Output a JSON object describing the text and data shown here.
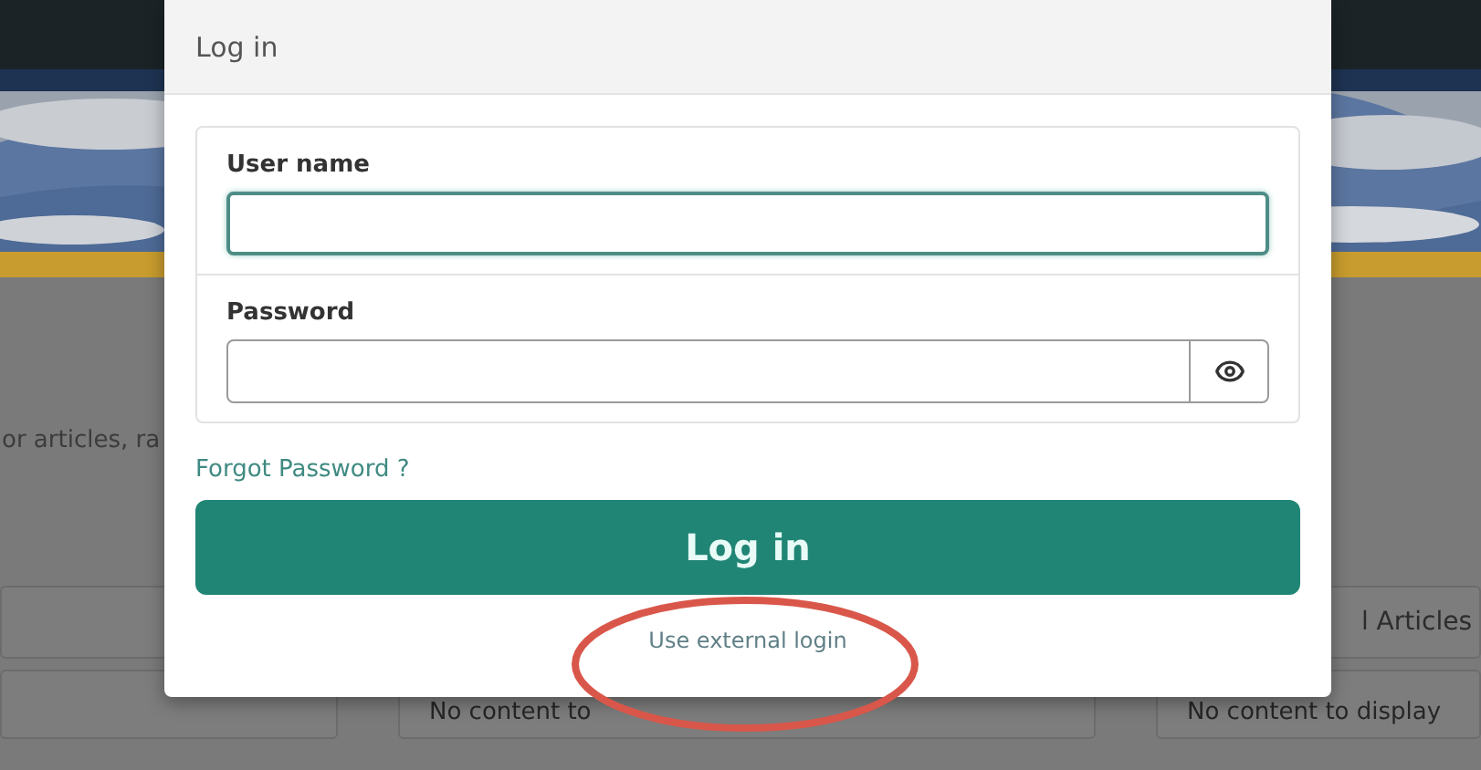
{
  "page": {
    "intro_text": "or articles, ra",
    "cards": [
      {
        "content": "No content to"
      },
      {
        "heading": "l Articles",
        "content": "No content to display"
      }
    ]
  },
  "dialog": {
    "title": "Log in",
    "fields": [
      {
        "label": "User name",
        "focused": true,
        "kind": "text"
      },
      {
        "label": "Password",
        "focused": false,
        "kind": "password"
      }
    ],
    "forgot_link": "Forgot Password ?",
    "submit": "Log in",
    "external_link": "Use external login",
    "highlighted": true
  }
}
